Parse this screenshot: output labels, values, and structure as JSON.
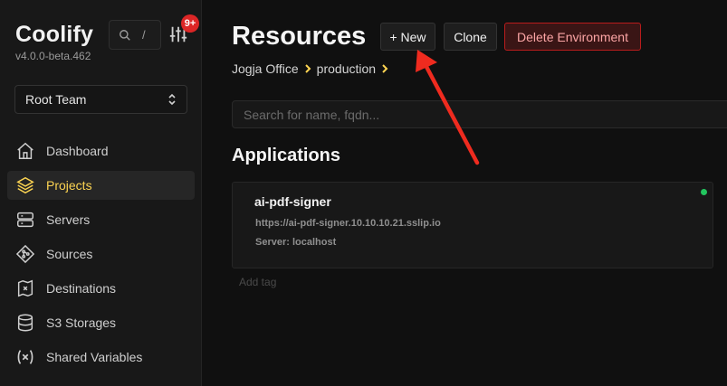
{
  "app": {
    "name": "Coolify",
    "version": "v4.0.0-beta.462"
  },
  "search": {
    "shortcut": "/"
  },
  "notifications": {
    "count": "9+"
  },
  "team": {
    "selected": "Root Team"
  },
  "sidebar": {
    "items": [
      {
        "label": "Dashboard",
        "icon": "home-icon",
        "active": false
      },
      {
        "label": "Projects",
        "icon": "layers-icon",
        "active": true
      },
      {
        "label": "Servers",
        "icon": "server-icon",
        "active": false
      },
      {
        "label": "Sources",
        "icon": "git-icon",
        "active": false
      },
      {
        "label": "Destinations",
        "icon": "destination-icon",
        "active": false
      },
      {
        "label": "S3 Storages",
        "icon": "database-icon",
        "active": false
      },
      {
        "label": "Shared Variables",
        "icon": "variable-icon",
        "active": false
      }
    ]
  },
  "page": {
    "title": "Resources",
    "new_label": "+ New",
    "clone_label": "Clone",
    "delete_label": "Delete Environment"
  },
  "breadcrumb": {
    "project": "Jogja Office",
    "environment": "production"
  },
  "resource_search": {
    "placeholder": "Search for name, fqdn..."
  },
  "applications": {
    "title": "Applications",
    "items": [
      {
        "name": "ai-pdf-signer",
        "url": "https://ai-pdf-signer.10.10.10.21.sslip.io",
        "server": "Server: localhost",
        "status_color": "#22c55e",
        "add_tag": "Add tag"
      }
    ]
  },
  "colors": {
    "accent": "#fcd452",
    "danger": "#b91c1c",
    "annotation": "#ef2b1f"
  }
}
